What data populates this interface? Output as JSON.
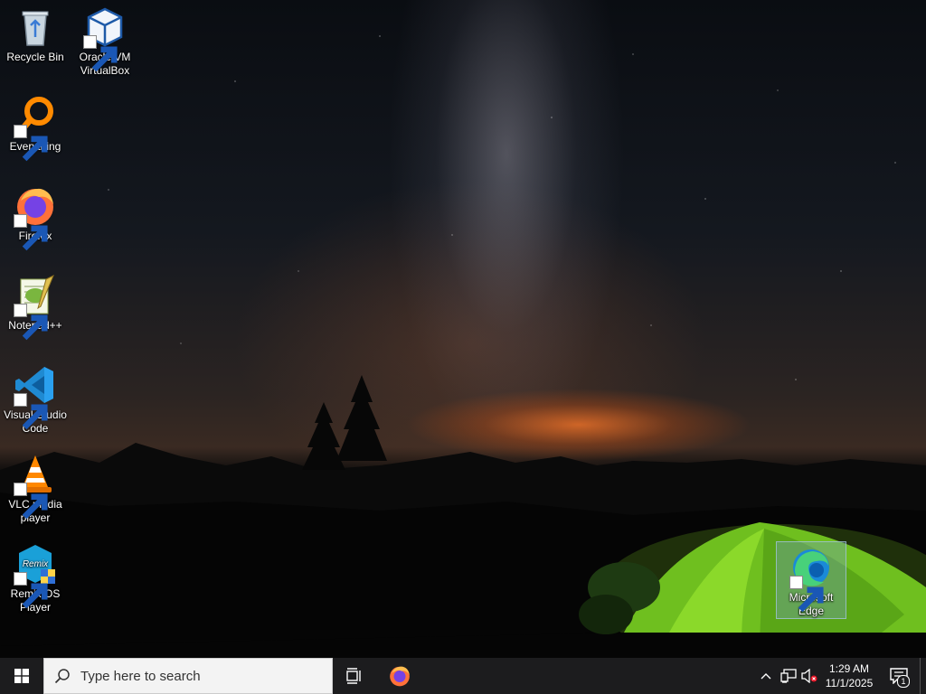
{
  "desktop": {
    "icons": [
      {
        "label": "Recycle Bin",
        "icon": "recycle-bin-icon",
        "shortcut": false
      },
      {
        "label": "Oracle VM VirtualBox",
        "icon": "virtualbox-icon",
        "shortcut": true
      },
      {
        "label": "Everything",
        "icon": "everything-search-icon",
        "shortcut": true
      },
      {
        "label": "Firefox",
        "icon": "firefox-icon",
        "shortcut": true
      },
      {
        "label": "Notepad++",
        "icon": "notepad-plus-plus-icon",
        "shortcut": true
      },
      {
        "label": "Visual Studio Code",
        "icon": "vscode-icon",
        "shortcut": true
      },
      {
        "label": "VLC media player",
        "icon": "vlc-icon",
        "shortcut": true
      },
      {
        "label": "Remix OS Player",
        "icon": "remix-os-icon",
        "shortcut": true
      },
      {
        "label": "Microsoft Edge",
        "icon": "edge-icon",
        "shortcut": true,
        "selected": true
      }
    ]
  },
  "taskbar": {
    "start_icon": "windows-start-icon",
    "search_placeholder": "Type here to search",
    "pinned": [
      {
        "name": "task-view",
        "icon": "task-view-icon"
      },
      {
        "name": "firefox",
        "icon": "firefox-icon"
      }
    ],
    "tray": {
      "chevron_icon": "chevron-up-icon",
      "network_icon": "network-icon",
      "volume_icon": "volume-muted-icon",
      "time": "1:29 AM",
      "date": "11/1/2025",
      "notification_count": "1"
    }
  },
  "colors": {
    "taskbar_bg": "#1c1c1e",
    "search_bg": "#f3f3f3",
    "windows_blue": "#ffffff"
  }
}
